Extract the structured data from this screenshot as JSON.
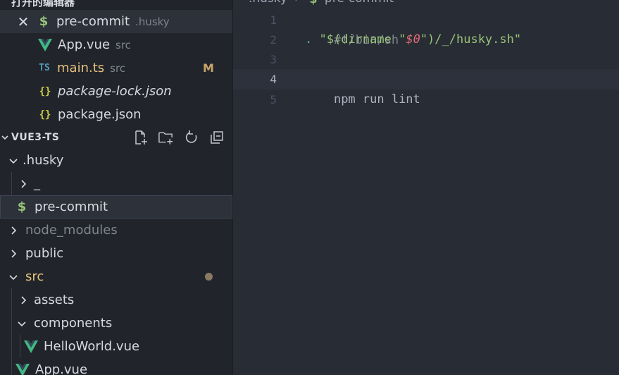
{
  "open_editors_header": "打开的编辑器",
  "open_editors": [
    {
      "label": "pre-commit",
      "desc": ".husky",
      "icon": "dollar-icon",
      "active": true
    },
    {
      "label": "App.vue",
      "desc": "src",
      "icon": "vue-icon"
    },
    {
      "label": "main.ts",
      "desc": "src",
      "icon": "ts-icon",
      "badge": "M"
    },
    {
      "label": "package-lock.json",
      "desc": "",
      "icon": "json-icon"
    },
    {
      "label": "package.json",
      "desc": "",
      "icon": "json-icon"
    }
  ],
  "explorer": {
    "title": "VUE3-TS",
    "tree": [
      {
        "label": ".husky",
        "type": "folder-open"
      },
      {
        "label": "_",
        "type": "folder-closed"
      },
      {
        "label": "pre-commit",
        "type": "file",
        "icon": "dollar-icon"
      },
      {
        "label": "node_modules",
        "type": "folder-closed"
      },
      {
        "label": "public",
        "type": "folder-closed"
      },
      {
        "label": "src",
        "type": "folder-open"
      },
      {
        "label": "assets",
        "type": "folder-closed"
      },
      {
        "label": "components",
        "type": "folder-open"
      },
      {
        "label": "HelloWorld.vue",
        "type": "file",
        "icon": "vue-icon"
      },
      {
        "label": "App.vue",
        "type": "file",
        "icon": "vue-icon"
      }
    ]
  },
  "breadcrumb": {
    "folder": ".husky",
    "file": "pre-commit"
  },
  "editor": {
    "line_numbers": [
      "1",
      "2",
      "3",
      "4",
      "5"
    ],
    "current_line": 4,
    "lines": {
      "l1": "#!/bin/sh",
      "l2_dot": ".",
      "l2_a": "\"$(dirname \"",
      "l2_var": "$0",
      "l2_b": "\")/_/husky.sh\"",
      "l4": "npm run lint"
    }
  },
  "colors": {
    "sidebar_bg": "#21252b",
    "editor_bg": "#282c34",
    "vue_green": "#41b883",
    "modified": "#e5c07b"
  }
}
